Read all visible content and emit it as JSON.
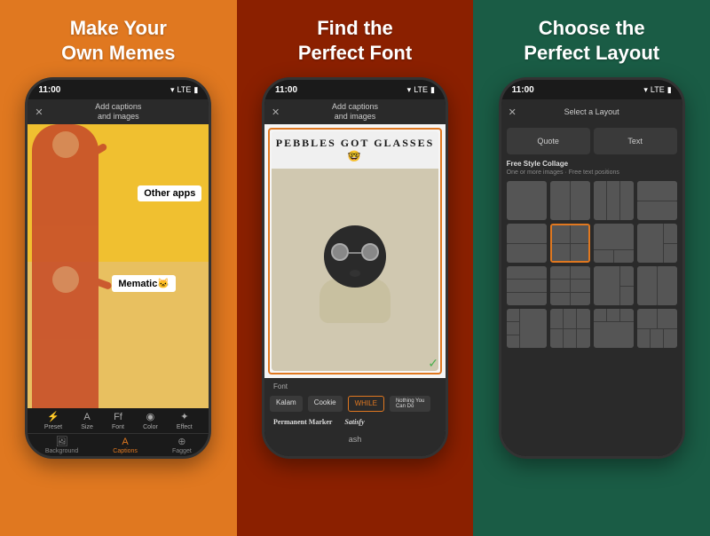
{
  "panels": [
    {
      "id": "panel-1",
      "title": "Make Your\nOwn Memes",
      "background": "#E07820",
      "phone": {
        "status_time": "11:00",
        "toolbar_title": "Add captions\nand images",
        "meme_top_label": "Other apps",
        "meme_bottom_label": "Mematic",
        "bottom_icons": [
          {
            "sym": "⚡",
            "label": "Preset",
            "active": false
          },
          {
            "sym": "A",
            "label": "Size",
            "active": false
          },
          {
            "sym": "Ff",
            "label": "Font",
            "active": false
          },
          {
            "sym": "●",
            "label": "Color",
            "active": false
          },
          {
            "sym": "✦",
            "label": "Effect",
            "active": false
          }
        ],
        "nav_items": [
          {
            "sym": "🖼",
            "label": "Background",
            "active": false
          },
          {
            "sym": "A",
            "label": "Captions",
            "active": true
          },
          {
            "sym": "⊕",
            "label": "Fagget",
            "active": false
          }
        ]
      }
    },
    {
      "id": "panel-2",
      "title": "Find the\nPerfect Font",
      "background": "#8B2000",
      "phone": {
        "status_time": "11:00",
        "toolbar_title": "Add captions\nand images",
        "meme_text": "PEBBLES GOT GLASSES 🤓",
        "font_label": "Font",
        "font_options": [
          {
            "name": "Kalam",
            "active": false
          },
          {
            "name": "Cookie",
            "active": false
          },
          {
            "name": "WHILE",
            "active": true
          },
          {
            "name": "Nothing You Can Do",
            "active": false
          }
        ],
        "font_options2": [
          {
            "name": "Permanent Marker",
            "style": "marker"
          },
          {
            "name": "Satisfy",
            "style": "script"
          }
        ]
      }
    },
    {
      "id": "panel-3",
      "title": "Choose the\nPerfect Layout",
      "background": "#1A5C45",
      "phone": {
        "status_time": "11:00",
        "toolbar_title": "Select a Layout",
        "layout_top": [
          {
            "label": "Quote"
          },
          {
            "label": "Text"
          }
        ],
        "free_style_title": "Free Style Collage",
        "free_style_sub": "One or more images · Free text positions",
        "layouts": [
          "full",
          "half-v",
          "thirds-v",
          "thirds-v-4",
          "half-h",
          "2x2",
          "right-col",
          "thirds-h",
          "big-top",
          "2x2b",
          "3col",
          "mosaic",
          "half-v2",
          "thirds-v2",
          "big-top2",
          "3col2"
        ]
      }
    }
  ]
}
